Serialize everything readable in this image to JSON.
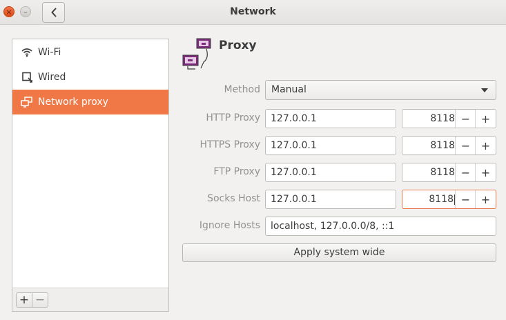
{
  "window": {
    "title": "Network",
    "close_glyph": "×",
    "minimize_glyph": "–"
  },
  "sidebar": {
    "items": [
      {
        "label": "Wi-Fi",
        "icon": "wifi-icon",
        "selected": false
      },
      {
        "label": "Wired",
        "icon": "wired-network-icon",
        "selected": false
      },
      {
        "label": "Network proxy",
        "icon": "network-proxy-icon",
        "selected": true
      }
    ],
    "add_label": "+",
    "remove_label": "−"
  },
  "proxy": {
    "title": "Proxy",
    "method_label": "Method",
    "method_value": "Manual",
    "rows": [
      {
        "label": "HTTP Proxy",
        "host": "127.0.0.1",
        "port": "8118"
      },
      {
        "label": "HTTPS Proxy",
        "host": "127.0.0.1",
        "port": "8118"
      },
      {
        "label": "FTP Proxy",
        "host": "127.0.0.1",
        "port": "8118"
      },
      {
        "label": "Socks Host",
        "host": "127.0.0.1",
        "port": "8118"
      }
    ],
    "ignore_label": "Ignore Hosts",
    "ignore_value": "localhost, 127.0.0.0/8, ::1",
    "decrement_label": "−",
    "increment_label": "+",
    "apply_label": "Apply system wide"
  },
  "colors": {
    "accent": "#f07746",
    "focus_border": "#e9784a",
    "label_grey": "#919191"
  }
}
